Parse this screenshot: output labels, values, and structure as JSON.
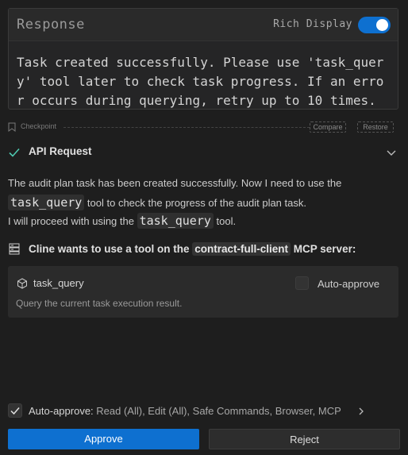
{
  "response": {
    "title": "Response",
    "rich_display_label": "Rich Display",
    "rich_display_enabled": true,
    "text": "Task created successfully. Please use 'task_query' tool later to check task progress. If an error occurs during querying, retry up to 10 times."
  },
  "checkpoint": {
    "label": "Checkpoint",
    "compare_label": "Compare",
    "restore_label": "Restore"
  },
  "api_request": {
    "label": "API Request",
    "status_icon": "check-icon",
    "expand_icon": "chevron-down-icon"
  },
  "message": {
    "p1_before": "The audit plan task has been created successfully. Now I need to use the ",
    "p1_code": "task_query",
    "p1_after": " tool to check the progress of the audit plan task.",
    "p2_before": "I will proceed with using the ",
    "p2_code": "task_query",
    "p2_after": " tool."
  },
  "mcp": {
    "prefix": "Cline wants to use a tool on the ",
    "server": "contract-full-client",
    "suffix": " MCP server:",
    "icon": "server-icon"
  },
  "tool": {
    "name": "task_query",
    "icon": "cube-icon",
    "auto_approve_label": "Auto-approve",
    "auto_approve_checked": false,
    "description": "Query the current task execution result."
  },
  "footer": {
    "label": "Auto-approve:",
    "value": " Read (All), Edit (All), Safe Commands, Browser, MCP",
    "checked": true
  },
  "buttons": {
    "approve": "Approve",
    "reject": "Reject"
  },
  "colors": {
    "accent": "#0e70d0",
    "background": "#1e1e1e",
    "success": "#4ec9b0"
  }
}
